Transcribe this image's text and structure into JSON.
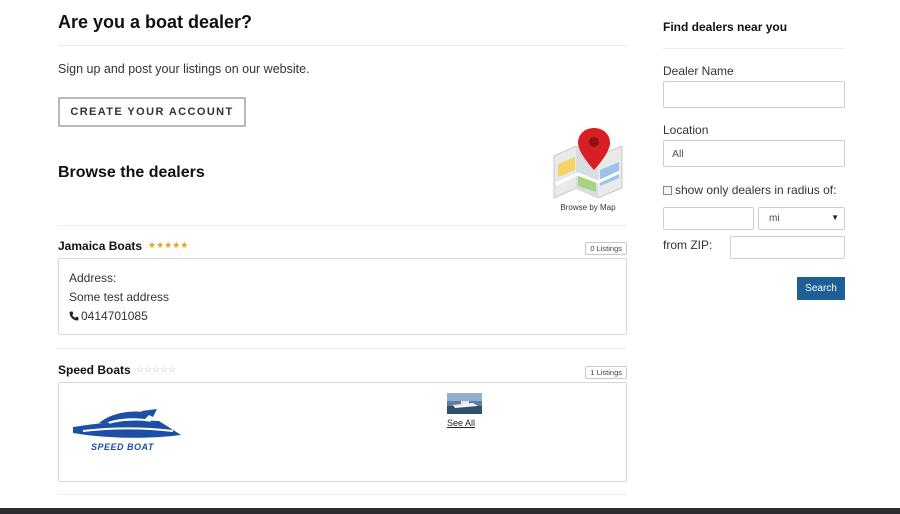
{
  "main": {
    "dealer_question": "Are you a boat dealer?",
    "signup_text": "Sign up and post your listings on our website.",
    "create_account_label": "CREATE YOUR ACCOUNT",
    "browse_title": "Browse the dealers",
    "map_link_label": "Browse by Map"
  },
  "dealers": [
    {
      "name": "Jamaica Boats",
      "stars": "★★★★★",
      "rating_filled": 5,
      "rating_max": 5,
      "listings_label": "0 Listings",
      "address_label": "Address:",
      "address": "Some test address",
      "phone": "0414701085",
      "phone_icon": "phone-icon"
    },
    {
      "name": "Speed Boats",
      "stars": "☆☆☆☆☆",
      "rating_filled": 0,
      "rating_max": 5,
      "listings_label": "1 Listings",
      "logo_text": "SPEED BOAT",
      "see_all_label": "See All"
    }
  ],
  "sidebar": {
    "title": "Find dealers near you",
    "dealer_name_label": "Dealer Name",
    "dealer_name_value": "",
    "location_label": "Location",
    "location_value": "All",
    "radius_label": "show only dealers in radius of:",
    "radius_value": "",
    "unit_value": "mi",
    "zip_label": "from ZIP:",
    "zip_value": "",
    "search_label": "Search"
  },
  "colors": {
    "accent": "#1e5f96",
    "star_filled": "#e8a317",
    "star_empty": "#bbbbbb",
    "logo_blue": "#1d4fa6",
    "footer": "#2c2c33"
  }
}
